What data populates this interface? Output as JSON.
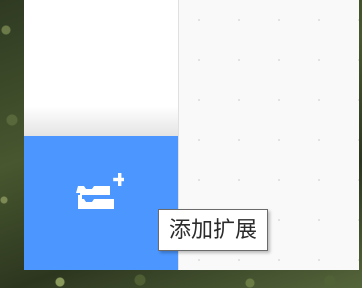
{
  "colors": {
    "extension_button_bg": "#4c97ff",
    "workspace_bg": "#f9f9f9",
    "tooltip_border": "#6b6b6b"
  },
  "extension_button": {
    "icon": "add-extension-icon"
  },
  "tooltip": {
    "text": "添加扩展"
  }
}
